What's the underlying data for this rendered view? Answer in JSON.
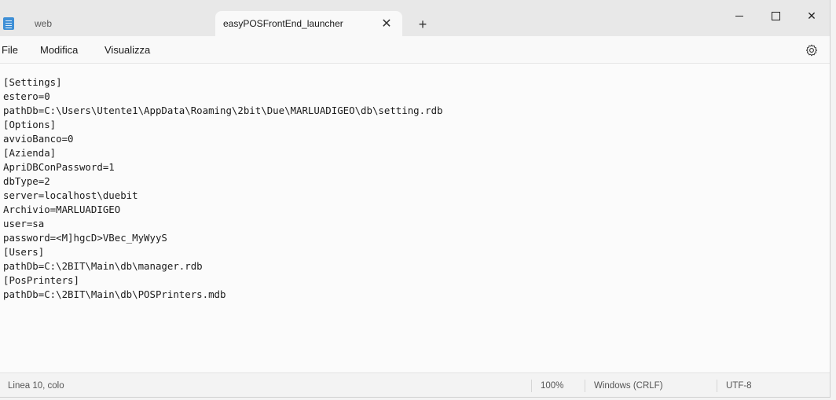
{
  "titlebar": {
    "tabs": [
      {
        "label": "web"
      },
      {
        "label": "easyPOSFrontEnd_launcher"
      }
    ],
    "close_tab_glyph": "✕",
    "new_tab_glyph": "+",
    "close_window_glyph": "✕"
  },
  "menu": {
    "file": "File",
    "edit": "Modifica",
    "view": "Visualizza"
  },
  "editor": {
    "content": "[Settings]\nestero=0\npathDb=C:\\Users\\Utente1\\AppData\\Roaming\\2bit\\Due\\MARLUADIGEO\\db\\setting.rdb\n[Options]\navvioBanco=0\n[Azienda]\nApriDBConPassword=1\ndbType=2\nserver=localhost\\duebit\nArchivio=MARLUADIGEO\nuser=sa\npassword=<M]hgcD>VBec_MyWyyS\n[Users]\npathDb=C:\\2BIT\\Main\\db\\manager.rdb\n[PosPrinters]\npathDb=C:\\2BIT\\Main\\db\\POSPrinters.mdb"
  },
  "status": {
    "position": "Linea 10, colo",
    "zoom": "100%",
    "line_ending": "Windows (CRLF)",
    "encoding": "UTF-8"
  },
  "icons": {
    "app": "notepad-icon",
    "settings": "gear-icon"
  }
}
